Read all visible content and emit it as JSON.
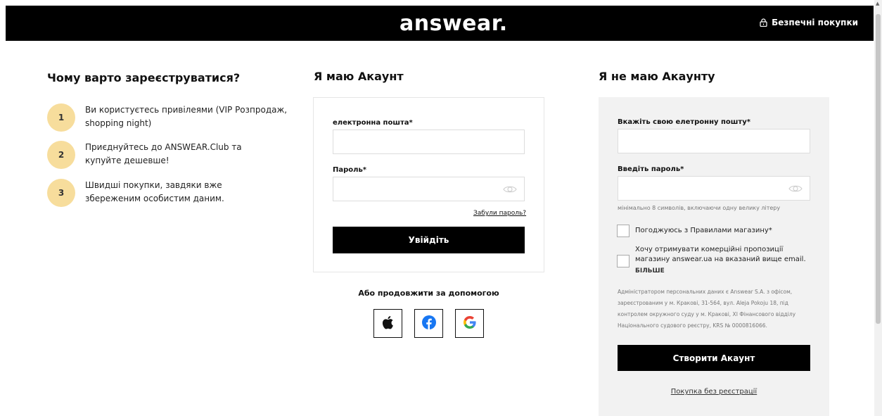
{
  "header": {
    "logo": "answear.",
    "secure_label": "Безпечні покупки"
  },
  "why": {
    "title": "Чому варто зареєструватися?",
    "items": [
      {
        "num": "1",
        "text": "Ви користуєтесь привілеями (VIP Розпродаж, shopping night)"
      },
      {
        "num": "2",
        "text": "Приєднуйтесь до ANSWEAR.Club та купуйте дешевше!"
      },
      {
        "num": "3",
        "text": "Швидші покупки, завдяки вже збереженим особистим даним."
      }
    ]
  },
  "login": {
    "title": "Я маю Акаунт",
    "email_label": "електронна пошта*",
    "email_value": "",
    "password_label": "Пароль*",
    "password_value": "",
    "forgot_label": "Забули пароль?",
    "submit_label": "Увійдіть",
    "or_label": "Або продовжити за допомогою",
    "social": [
      "apple-icon",
      "facebook-icon",
      "google-icon"
    ]
  },
  "register": {
    "title": "Я не маю Акаунту",
    "email_label": "Вкажіть свою елетронну пошту*",
    "email_value": "",
    "password_label": "Введіть пароль*",
    "password_value": "",
    "password_hint": "мінімально 8 символів, включаючи одну велику літеру",
    "terms_label": "Погоджуюсь з Правилами магазину*",
    "terms_checked": false,
    "newsletter_label": "Хочу отримувати комерційні пропозиції магазину answear.ua на вказаний вище email.",
    "newsletter_checked": false,
    "more_label": "БІЛЬШЕ",
    "admin_text": "Адміністратором персональних даних є Answear S.A. з офісом, зареєстрованим у м. Кракові, 31-564, вул. Aleja Pokoju 18, під контролем окружного суду у м. Кракові, XI Фінансового відділу Національного судового реєстру, KRS № 0000816066.",
    "submit_label": "Створити Акаунт",
    "guest_label": "Покупка без реєстрації"
  },
  "colors": {
    "accent_circle": "#f7dd9c",
    "header_bg": "#000000",
    "panel_bg": "#f2f2f2"
  }
}
